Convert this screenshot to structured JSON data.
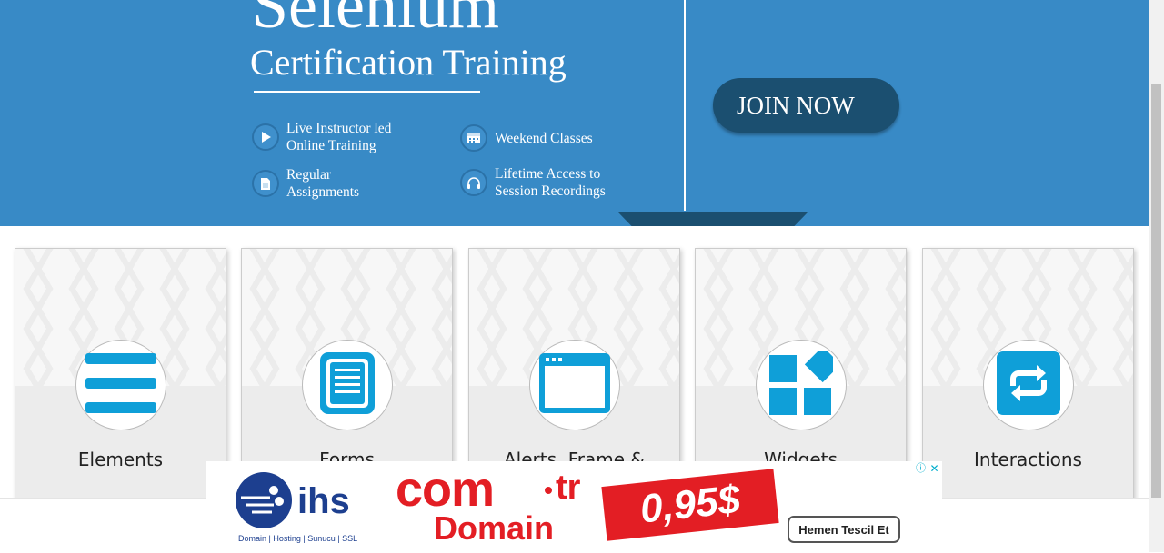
{
  "banner": {
    "title": "Selenium",
    "subtitle": "Certification Training",
    "features": [
      {
        "line1": "Live Instructor led",
        "line2": "Online Training",
        "icon": "play-icon"
      },
      {
        "line1": "Weekend Classes",
        "line2": "",
        "icon": "calendar-icon"
      },
      {
        "line1": "Regular",
        "line2": "Assignments",
        "icon": "document-icon"
      },
      {
        "line1": "Lifetime Access to",
        "line2": "Session Recordings",
        "icon": "headphones-icon"
      }
    ],
    "join_label": "JOIN NOW",
    "colors": {
      "background": "#388ac6",
      "button": "#1b4f70"
    }
  },
  "cards": [
    {
      "label": "Elements",
      "icon": "hamburger-list-icon"
    },
    {
      "label": "Forms",
      "icon": "form-document-icon"
    },
    {
      "label": "Alerts, Frame & Windows",
      "icon": "browser-window-icon"
    },
    {
      "label": "Widgets",
      "icon": "widgets-grid-icon"
    },
    {
      "label": "Interactions",
      "icon": "repeat-arrows-icon"
    }
  ],
  "ad": {
    "brand": "ihs",
    "brand_tagline": "Domain | Hosting | Sunucu | SSL",
    "product_main": "com",
    "product_suffix": "tr",
    "product_domain": "Domain",
    "price": "0,95$",
    "cta": "Hemen Tescil Et",
    "colors": {
      "accent": "#e31e24",
      "brand_blue": "#1d3f8f"
    }
  }
}
